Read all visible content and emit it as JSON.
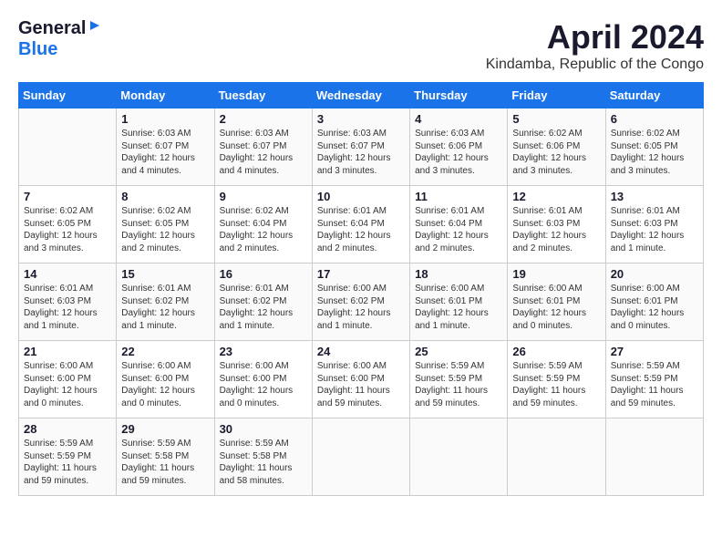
{
  "header": {
    "logo_line1": "General",
    "logo_line2": "Blue",
    "main_title": "April 2024",
    "subtitle": "Kindamba, Republic of the Congo"
  },
  "calendar": {
    "weekdays": [
      "Sunday",
      "Monday",
      "Tuesday",
      "Wednesday",
      "Thursday",
      "Friday",
      "Saturday"
    ],
    "weeks": [
      [
        {
          "day": "",
          "info": ""
        },
        {
          "day": "1",
          "info": "Sunrise: 6:03 AM\nSunset: 6:07 PM\nDaylight: 12 hours\nand 4 minutes."
        },
        {
          "day": "2",
          "info": "Sunrise: 6:03 AM\nSunset: 6:07 PM\nDaylight: 12 hours\nand 4 minutes."
        },
        {
          "day": "3",
          "info": "Sunrise: 6:03 AM\nSunset: 6:07 PM\nDaylight: 12 hours\nand 3 minutes."
        },
        {
          "day": "4",
          "info": "Sunrise: 6:03 AM\nSunset: 6:06 PM\nDaylight: 12 hours\nand 3 minutes."
        },
        {
          "day": "5",
          "info": "Sunrise: 6:02 AM\nSunset: 6:06 PM\nDaylight: 12 hours\nand 3 minutes."
        },
        {
          "day": "6",
          "info": "Sunrise: 6:02 AM\nSunset: 6:05 PM\nDaylight: 12 hours\nand 3 minutes."
        }
      ],
      [
        {
          "day": "7",
          "info": "Sunrise: 6:02 AM\nSunset: 6:05 PM\nDaylight: 12 hours\nand 3 minutes."
        },
        {
          "day": "8",
          "info": "Sunrise: 6:02 AM\nSunset: 6:05 PM\nDaylight: 12 hours\nand 2 minutes."
        },
        {
          "day": "9",
          "info": "Sunrise: 6:02 AM\nSunset: 6:04 PM\nDaylight: 12 hours\nand 2 minutes."
        },
        {
          "day": "10",
          "info": "Sunrise: 6:01 AM\nSunset: 6:04 PM\nDaylight: 12 hours\nand 2 minutes."
        },
        {
          "day": "11",
          "info": "Sunrise: 6:01 AM\nSunset: 6:04 PM\nDaylight: 12 hours\nand 2 minutes."
        },
        {
          "day": "12",
          "info": "Sunrise: 6:01 AM\nSunset: 6:03 PM\nDaylight: 12 hours\nand 2 minutes."
        },
        {
          "day": "13",
          "info": "Sunrise: 6:01 AM\nSunset: 6:03 PM\nDaylight: 12 hours\nand 1 minute."
        }
      ],
      [
        {
          "day": "14",
          "info": "Sunrise: 6:01 AM\nSunset: 6:03 PM\nDaylight: 12 hours\nand 1 minute."
        },
        {
          "day": "15",
          "info": "Sunrise: 6:01 AM\nSunset: 6:02 PM\nDaylight: 12 hours\nand 1 minute."
        },
        {
          "day": "16",
          "info": "Sunrise: 6:01 AM\nSunset: 6:02 PM\nDaylight: 12 hours\nand 1 minute."
        },
        {
          "day": "17",
          "info": "Sunrise: 6:00 AM\nSunset: 6:02 PM\nDaylight: 12 hours\nand 1 minute."
        },
        {
          "day": "18",
          "info": "Sunrise: 6:00 AM\nSunset: 6:01 PM\nDaylight: 12 hours\nand 1 minute."
        },
        {
          "day": "19",
          "info": "Sunrise: 6:00 AM\nSunset: 6:01 PM\nDaylight: 12 hours\nand 0 minutes."
        },
        {
          "day": "20",
          "info": "Sunrise: 6:00 AM\nSunset: 6:01 PM\nDaylight: 12 hours\nand 0 minutes."
        }
      ],
      [
        {
          "day": "21",
          "info": "Sunrise: 6:00 AM\nSunset: 6:00 PM\nDaylight: 12 hours\nand 0 minutes."
        },
        {
          "day": "22",
          "info": "Sunrise: 6:00 AM\nSunset: 6:00 PM\nDaylight: 12 hours\nand 0 minutes."
        },
        {
          "day": "23",
          "info": "Sunrise: 6:00 AM\nSunset: 6:00 PM\nDaylight: 12 hours\nand 0 minutes."
        },
        {
          "day": "24",
          "info": "Sunrise: 6:00 AM\nSunset: 6:00 PM\nDaylight: 11 hours\nand 59 minutes."
        },
        {
          "day": "25",
          "info": "Sunrise: 5:59 AM\nSunset: 5:59 PM\nDaylight: 11 hours\nand 59 minutes."
        },
        {
          "day": "26",
          "info": "Sunrise: 5:59 AM\nSunset: 5:59 PM\nDaylight: 11 hours\nand 59 minutes."
        },
        {
          "day": "27",
          "info": "Sunrise: 5:59 AM\nSunset: 5:59 PM\nDaylight: 11 hours\nand 59 minutes."
        }
      ],
      [
        {
          "day": "28",
          "info": "Sunrise: 5:59 AM\nSunset: 5:59 PM\nDaylight: 11 hours\nand 59 minutes."
        },
        {
          "day": "29",
          "info": "Sunrise: 5:59 AM\nSunset: 5:58 PM\nDaylight: 11 hours\nand 59 minutes."
        },
        {
          "day": "30",
          "info": "Sunrise: 5:59 AM\nSunset: 5:58 PM\nDaylight: 11 hours\nand 58 minutes."
        },
        {
          "day": "",
          "info": ""
        },
        {
          "day": "",
          "info": ""
        },
        {
          "day": "",
          "info": ""
        },
        {
          "day": "",
          "info": ""
        }
      ]
    ]
  }
}
